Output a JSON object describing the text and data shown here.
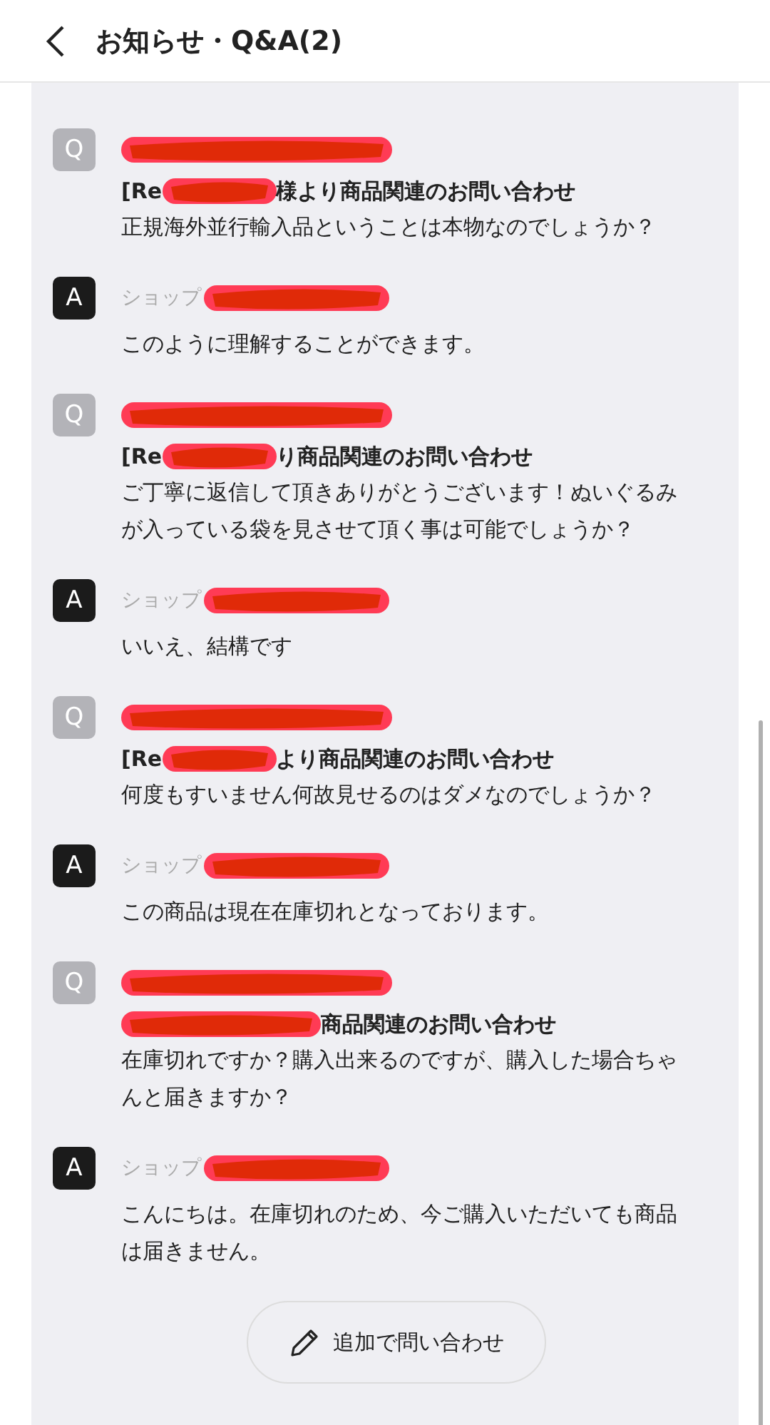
{
  "header": {
    "title": "お知らせ・Q&A(2)"
  },
  "threads": [
    {
      "question": {
        "badge": "Q",
        "subject_start": "[Re",
        "subject_end": "様より商品関連のお問い合わせ",
        "body": "正規海外並行輸入品ということは本物なのでしょうか？"
      },
      "answer": {
        "badge": "A",
        "sender": "ショップ",
        "body": "このように理解することができます。"
      }
    },
    {
      "question": {
        "badge": "Q",
        "subject_start": "[Re",
        "subject_end": "り商品関連のお問い合わせ",
        "body": "ご丁寧に返信して頂きありがとうございます！ぬいぐるみが入っている袋を見させて頂く事は可能でしょうか？"
      },
      "answer": {
        "badge": "A",
        "sender": "ショップ",
        "body": "いいえ、結構です"
      }
    },
    {
      "question": {
        "badge": "Q",
        "subject_start": "[Re",
        "subject_end": "より商品関連のお問い合わせ",
        "body": "何度もすいません何故見せるのはダメなのでしょうか？"
      },
      "answer": {
        "badge": "A",
        "sender": "ショップ",
        "body": "この商品は現在在庫切れとなっております。"
      }
    },
    {
      "question": {
        "badge": "Q",
        "subject_end": "商品関連のお問い合わせ",
        "body": "在庫切れですか？購入出来るのですが、購入した場合ちゃんと届きますか？"
      },
      "answer": {
        "badge": "A",
        "sender": "ショップ",
        "body": "こんにちは。在庫切れのため、今ご購入いただいても商品は届きません。"
      }
    }
  ],
  "follow_up_button": {
    "label": "追加で問い合わせ"
  }
}
